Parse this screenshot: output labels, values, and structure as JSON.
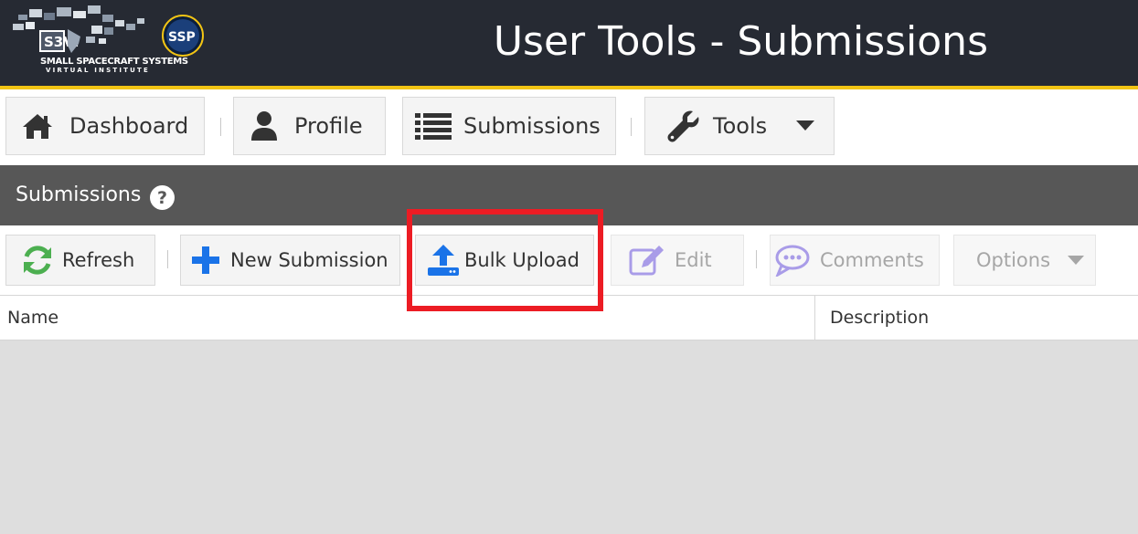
{
  "header": {
    "logo_main": "S3VI",
    "logo_line1": "SMALL SPACECRAFT SYSTEMS",
    "logo_line2": "VIRTUAL INSTITUTE",
    "logo_badge": "SSP",
    "title": "User Tools - Submissions"
  },
  "nav": {
    "items": [
      {
        "label": "Dashboard",
        "icon": "home-icon"
      },
      {
        "label": "Profile",
        "icon": "user-icon"
      },
      {
        "label": "Submissions",
        "icon": "list-icon"
      },
      {
        "label": "Tools",
        "icon": "wrench-icon"
      }
    ]
  },
  "panel": {
    "title": "Submissions",
    "help": "?"
  },
  "toolbar": {
    "refresh": "Refresh",
    "new_submission": "New Submission",
    "bulk_upload": "Bulk Upload",
    "edit": "Edit",
    "comments": "Comments",
    "options": "Options"
  },
  "table": {
    "columns": [
      "Name",
      "Description"
    ]
  },
  "colors": {
    "header_bg": "#262a33",
    "accent": "#f2c414",
    "panel_bg": "#575757",
    "highlight": "#ec1c24",
    "refresh_green": "#4caf50",
    "primary_blue": "#1a73e8",
    "disabled_purple": "#a99ce8"
  }
}
